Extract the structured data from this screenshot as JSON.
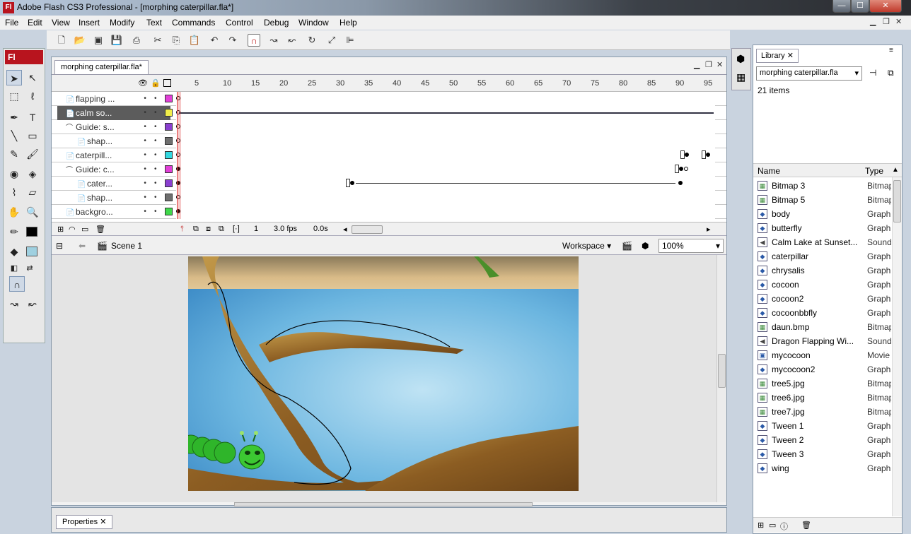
{
  "window": {
    "app_icon": "Fl",
    "title": "Adobe Flash CS3 Professional - [morphing caterpillar.fla*]",
    "min": "—",
    "max": "☐",
    "close": "✕"
  },
  "menu": [
    "File",
    "Edit",
    "View",
    "Insert",
    "Modify",
    "Text",
    "Commands",
    "Control",
    "Debug",
    "Window",
    "Help"
  ],
  "tools_header": "Fl",
  "document": {
    "tab_label": "morphing caterpillar.fla*",
    "timeline": {
      "ruler": [
        "5",
        "10",
        "15",
        "20",
        "25",
        "30",
        "35",
        "40",
        "45",
        "50",
        "55",
        "60",
        "65",
        "70",
        "75",
        "80",
        "85",
        "90",
        "95"
      ],
      "layers": [
        {
          "name": "flapping ...",
          "color": "#e23fd8"
        },
        {
          "name": "calm so...",
          "color": "#f2ef4a"
        },
        {
          "name": "Guide: s...",
          "color": "#8a3fd0"
        },
        {
          "name": "shap...",
          "color": "#6e6e6e"
        },
        {
          "name": "caterpill...",
          "color": "#33d8e0"
        },
        {
          "name": "Guide: c...",
          "color": "#e23fd8"
        },
        {
          "name": "cater...",
          "color": "#8a3fd0"
        },
        {
          "name": "shap...",
          "color": "#6e6e6e"
        },
        {
          "name": "backgro...",
          "color": "#3fd84a"
        }
      ],
      "footer": {
        "frame": "1",
        "fps": "3.0 fps",
        "time": "0.0s"
      }
    },
    "editbar": {
      "scene": "Scene 1",
      "workspace": "Workspace ▾",
      "zoom": "100%"
    }
  },
  "properties_tab": "Properties",
  "library": {
    "tab_label": "Library",
    "selected_doc": "morphing caterpillar.fla",
    "count": "21 items",
    "col_name": "Name",
    "col_type": "Type",
    "items": [
      {
        "name": "Bitmap 3",
        "type": "Bitmap",
        "icon": "bitmap"
      },
      {
        "name": "Bitmap 5",
        "type": "Bitmap",
        "icon": "bitmap"
      },
      {
        "name": "body",
        "type": "Graphic",
        "icon": "graphic"
      },
      {
        "name": "butterfly",
        "type": "Graphic",
        "icon": "graphic"
      },
      {
        "name": "Calm Lake at Sunset...",
        "type": "Sound",
        "icon": "sound"
      },
      {
        "name": "caterpillar",
        "type": "Graphic",
        "icon": "graphic"
      },
      {
        "name": "chrysalis",
        "type": "Graphic",
        "icon": "graphic"
      },
      {
        "name": "cocoon",
        "type": "Graphic",
        "icon": "graphic"
      },
      {
        "name": "cocoon2",
        "type": "Graphic",
        "icon": "graphic"
      },
      {
        "name": "cocoonbbfly",
        "type": "Graphic",
        "icon": "graphic"
      },
      {
        "name": "daun.bmp",
        "type": "Bitmap",
        "icon": "bitmap"
      },
      {
        "name": "Dragon Flapping Wi...",
        "type": "Sound",
        "icon": "sound"
      },
      {
        "name": "mycocoon",
        "type": "Movie",
        "icon": "movie"
      },
      {
        "name": "mycocoon2",
        "type": "Graphic",
        "icon": "graphic"
      },
      {
        "name": "tree5.jpg",
        "type": "Bitmap",
        "icon": "bitmap"
      },
      {
        "name": "tree6.jpg",
        "type": "Bitmap",
        "icon": "bitmap"
      },
      {
        "name": "tree7.jpg",
        "type": "Bitmap",
        "icon": "bitmap"
      },
      {
        "name": "Tween 1",
        "type": "Graphic",
        "icon": "graphic"
      },
      {
        "name": "Tween 2",
        "type": "Graphic",
        "icon": "graphic"
      },
      {
        "name": "Tween 3",
        "type": "Graphic",
        "icon": "graphic"
      },
      {
        "name": "wing",
        "type": "Graphic",
        "icon": "graphic"
      }
    ]
  }
}
